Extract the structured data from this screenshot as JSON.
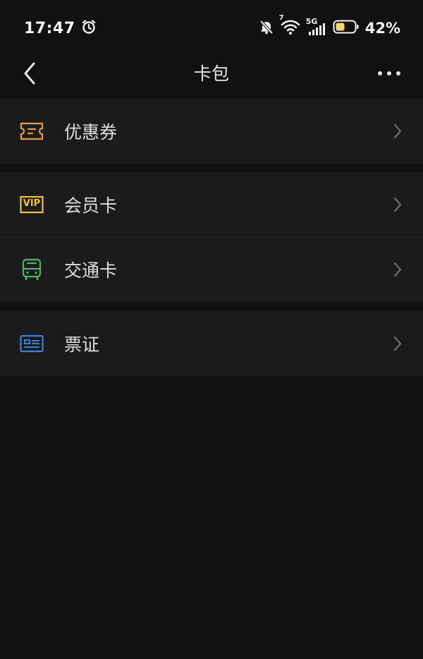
{
  "status_bar": {
    "time": "17:47",
    "battery_percent": "42%",
    "network_label": "5G",
    "wifi_badge": "7"
  },
  "nav": {
    "title": "卡包"
  },
  "list": {
    "coupons": {
      "label": "优惠券",
      "icon": "ticket-icon",
      "color": "#e39a4d"
    },
    "membership": {
      "label": "会员卡",
      "icon": "vip-icon",
      "color": "#f1c04a",
      "icon_text": "VIP"
    },
    "transit": {
      "label": "交通卡",
      "icon": "bus-icon",
      "color": "#4fb36b"
    },
    "passes": {
      "label": "票证",
      "icon": "id-card-icon",
      "color": "#3b7fd6"
    }
  },
  "colors": {
    "background": "#111111",
    "row_background": "#1b1b1b"
  }
}
